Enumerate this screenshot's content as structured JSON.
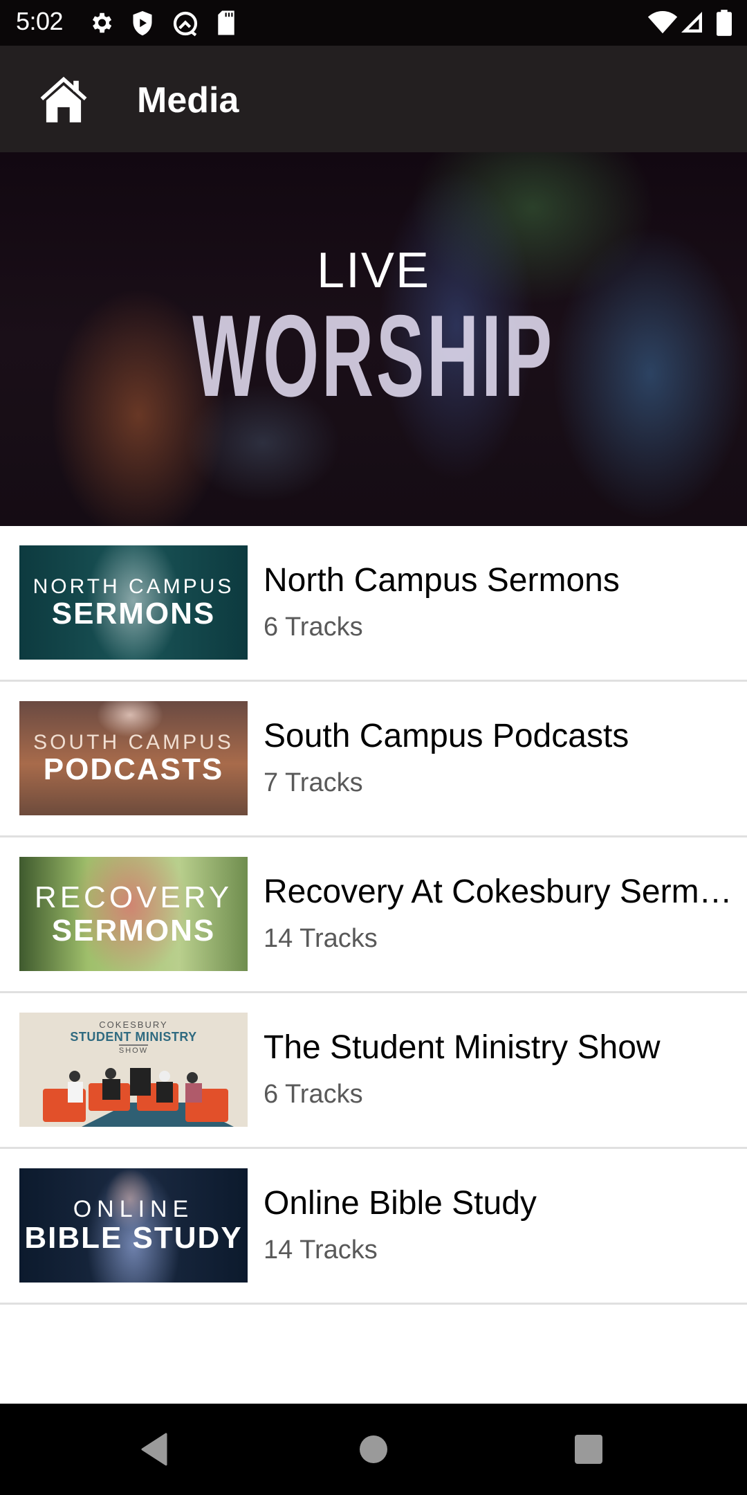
{
  "status_bar": {
    "time": "5:02",
    "left_icons": [
      "gear-icon",
      "shield-play-icon",
      "circle-arrow-icon",
      "sd-card-icon"
    ],
    "right_icons": [
      "wifi-icon",
      "signal-icon",
      "battery-icon"
    ]
  },
  "app_bar": {
    "title": "Media",
    "home_icon": "home-icon"
  },
  "hero": {
    "line1": "LIVE",
    "line2": "WORSHIP"
  },
  "media_list": [
    {
      "title": "North Campus Sermons",
      "subtitle": "6 Tracks",
      "thumb_line1": "NORTH CAMPUS",
      "thumb_line2": "SERMONS"
    },
    {
      "title": "South Campus Podcasts",
      "subtitle": "7 Tracks",
      "thumb_line1": "SOUTH CAMPUS",
      "thumb_line2": "PODCASTS"
    },
    {
      "title": "Recovery At Cokesbury Serm…",
      "subtitle": "14 Tracks",
      "thumb_line1": "RECOVERY",
      "thumb_line2": "SERMONS"
    },
    {
      "title": "The Student Ministry Show",
      "subtitle": "6 Tracks",
      "thumb_top": "COKESBURY",
      "thumb_main": "STUDENT MINISTRY",
      "thumb_show": "SHOW"
    },
    {
      "title": "Online Bible Study",
      "subtitle": "14 Tracks",
      "thumb_line1": "ONLINE",
      "thumb_line2": "BIBLE STUDY"
    }
  ],
  "nav_bar": {
    "buttons": [
      "back-icon",
      "home-circle-icon",
      "recents-icon"
    ]
  }
}
